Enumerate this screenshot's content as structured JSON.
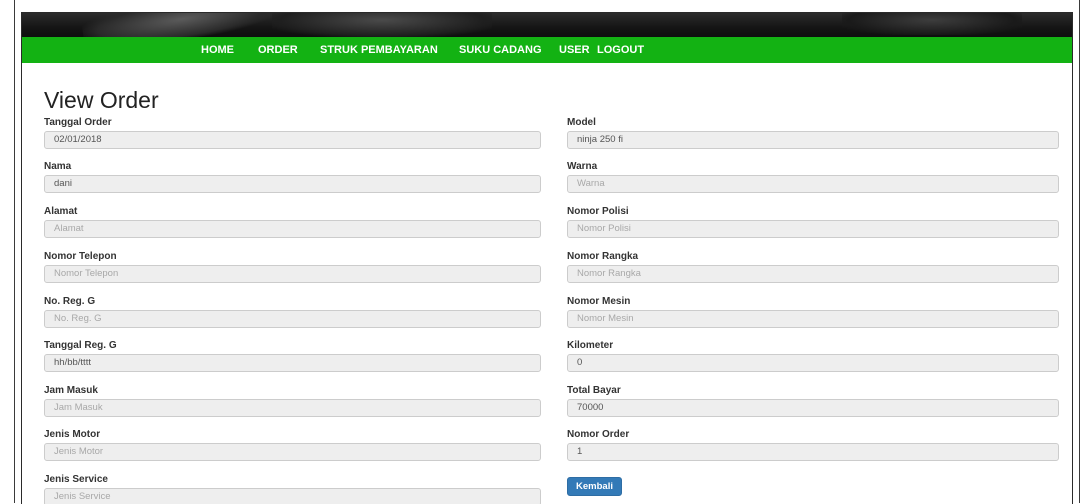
{
  "nav": {
    "items": [
      {
        "label": "HOME"
      },
      {
        "label": "ORDER"
      },
      {
        "label": "STRUK PEMBAYARAN"
      },
      {
        "label": "SUKU CADANG"
      },
      {
        "label": "USER"
      },
      {
        "label": "LOGOUT"
      }
    ]
  },
  "page": {
    "title": "View Order"
  },
  "left_fields": [
    {
      "label": "Tanggal Order",
      "value": "02/01/2018",
      "placeholder": ""
    },
    {
      "label": "Nama",
      "value": "dani",
      "placeholder": ""
    },
    {
      "label": "Alamat",
      "value": "",
      "placeholder": "Alamat"
    },
    {
      "label": "Nomor Telepon",
      "value": "",
      "placeholder": "Nomor Telepon"
    },
    {
      "label": "No. Reg. G",
      "value": "",
      "placeholder": "No. Reg. G"
    },
    {
      "label": "Tanggal Reg. G",
      "value": "hh/bb/tttt",
      "placeholder": ""
    },
    {
      "label": "Jam Masuk",
      "value": "",
      "placeholder": "Jam Masuk"
    },
    {
      "label": "Jenis Motor",
      "value": "",
      "placeholder": "Jenis Motor"
    },
    {
      "label": "Jenis Service",
      "value": "",
      "placeholder": "Jenis Service"
    }
  ],
  "right_fields": [
    {
      "label": "Model",
      "value": "ninja 250 fi",
      "placeholder": ""
    },
    {
      "label": "Warna",
      "value": "",
      "placeholder": "Warna"
    },
    {
      "label": "Nomor Polisi",
      "value": "",
      "placeholder": "Nomor Polisi"
    },
    {
      "label": "Nomor Rangka",
      "value": "",
      "placeholder": "Nomor Rangka"
    },
    {
      "label": "Nomor Mesin",
      "value": "",
      "placeholder": "Nomor Mesin"
    },
    {
      "label": "Kilometer",
      "value": "0",
      "placeholder": ""
    },
    {
      "label": "Total Bayar",
      "value": "70000",
      "placeholder": ""
    },
    {
      "label": "Nomor Order",
      "value": "1",
      "placeholder": ""
    }
  ],
  "actions": {
    "back_label": "Kembali"
  },
  "colors": {
    "navbar": "#13b213",
    "button": "#337ab7"
  }
}
